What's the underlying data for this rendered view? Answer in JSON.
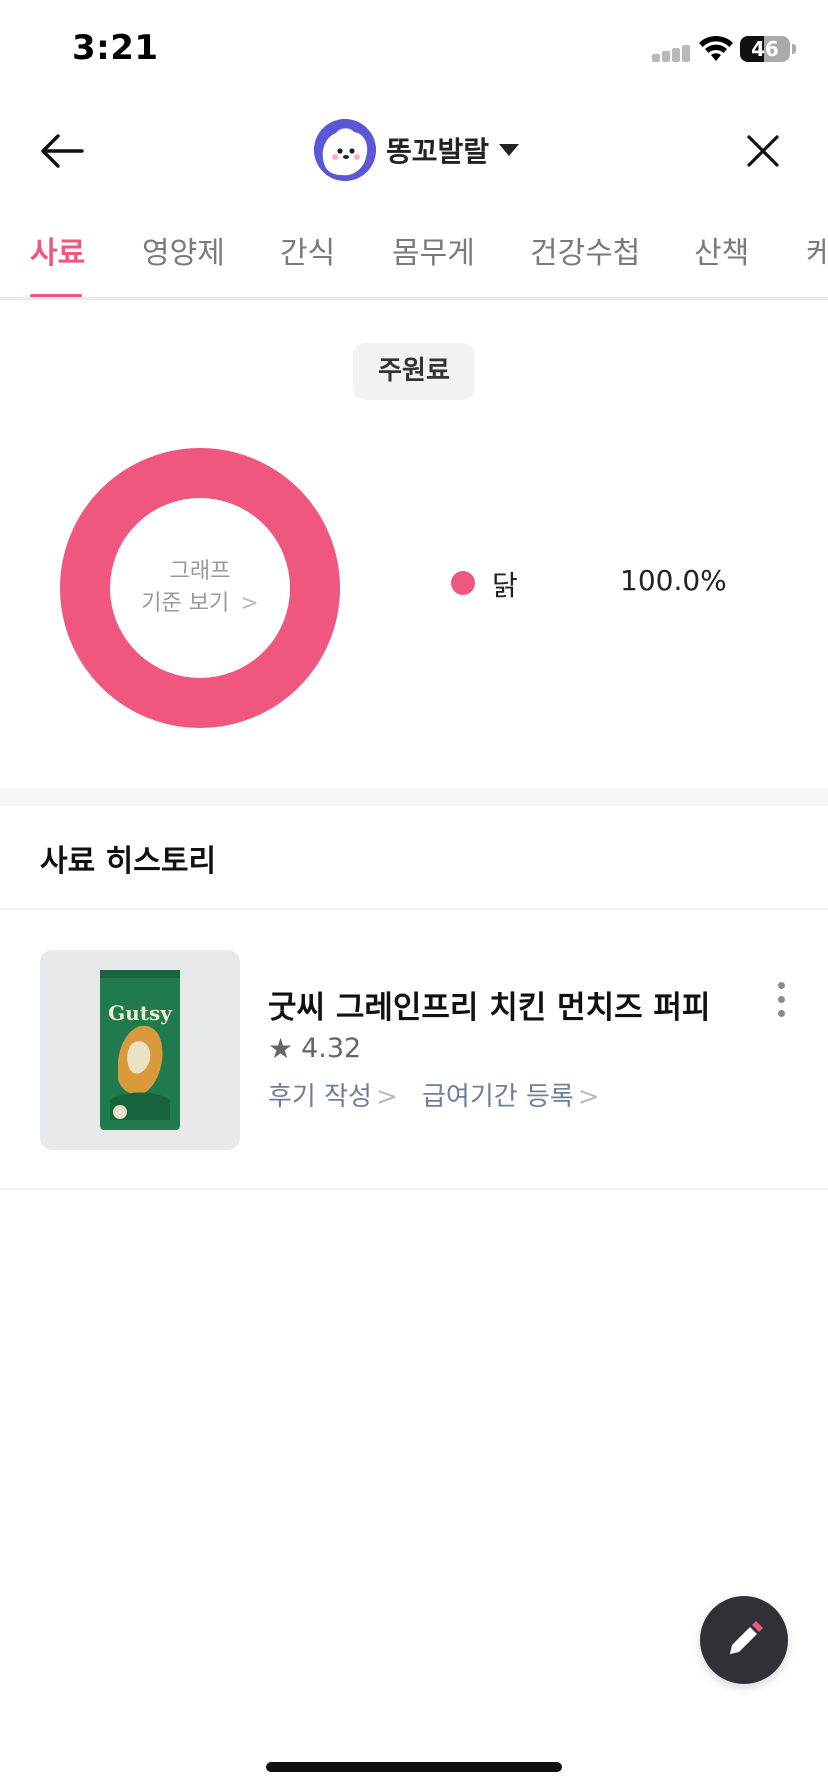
{
  "status_bar": {
    "time": "3:21",
    "battery": "46"
  },
  "header": {
    "pet_name": "똥꼬발랄"
  },
  "tabs": [
    {
      "label": "사료",
      "active": true
    },
    {
      "label": "영양제",
      "active": false
    },
    {
      "label": "간식",
      "active": false
    },
    {
      "label": "몸무게",
      "active": false
    },
    {
      "label": "건강수첩",
      "active": false
    },
    {
      "label": "산책",
      "active": false
    },
    {
      "label": "케",
      "active": false
    }
  ],
  "ingredients": {
    "chip_label": "주원료",
    "center_label_1": "그래프",
    "center_label_2": "기준 보기",
    "center_chevron": ">",
    "accent_color": "#f0577e"
  },
  "chart_data": {
    "type": "pie",
    "categories": [
      "닭"
    ],
    "values": [
      100.0
    ],
    "labels": [
      "100.0%"
    ],
    "colors": [
      "#f0577e"
    ]
  },
  "history": {
    "title": "사료 히스토리",
    "items": [
      {
        "name": "굿씨 그레인프리 치킨 먼치즈 퍼피",
        "rating": "4.32",
        "review_link": "후기 작성",
        "period_link": "급여기간 등록",
        "chevron": ">",
        "package_brand": "Gutsy"
      }
    ]
  }
}
